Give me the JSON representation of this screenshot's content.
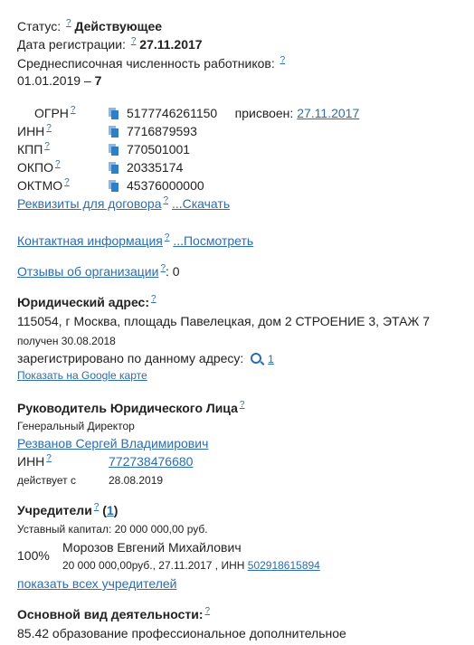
{
  "status": {
    "label": "Статус:",
    "q": "?",
    "value": "Действующее"
  },
  "reg_date": {
    "label": "Дата регистрации:",
    "q": "?",
    "value": "27.11.2017"
  },
  "headcount": {
    "label": "Среднесписочная численность работников:",
    "q": "?",
    "date": "01.01.2019",
    "dash": "–",
    "value": "7"
  },
  "codes": {
    "ogrn": {
      "label": "ОГРН",
      "q": "?",
      "value": "5177746261150",
      "assigned_label": "присвоен:",
      "assigned_date": "27.11.2017"
    },
    "inn": {
      "label": "ИНН",
      "q": "?",
      "value": "7716879593"
    },
    "kpp": {
      "label": "КПП",
      "q": "?",
      "value": "770501001"
    },
    "okpo": {
      "label": "ОКПО",
      "q": "?",
      "value": "20335174"
    },
    "oktmo": {
      "label": "ОКТМО",
      "q": "?",
      "value": "45376000000"
    }
  },
  "requisites": {
    "link": "Реквизиты для договора",
    "q": "?",
    "action": "...Скачать"
  },
  "contacts": {
    "link": "Контактная информация",
    "q": "?",
    "action": "...Посмотреть"
  },
  "reviews": {
    "link": "Отзывы об организации",
    "q": "?",
    "count": ": 0"
  },
  "address": {
    "title": "Юридический адрес:",
    "q": "?",
    "value": "115054, г Москва, площадь Павелецкая, дом 2 СТРОЕНИЕ 3, ЭТАЖ 7",
    "received": "получен 30.08.2018",
    "registered_label": "зарегистрировано по данному адресу:",
    "registered_count": "1",
    "map_link": "Показать на Google карте"
  },
  "head": {
    "title": "Руководитель Юридического Лица",
    "q": "?",
    "position": "Генеральный Директор",
    "name": "Резванов Сергей Владимирович",
    "inn_label": "ИНН",
    "inn_q": "?",
    "inn_value": "772738476680",
    "since_label": "действует с",
    "since_value": "28.08.2019"
  },
  "founders": {
    "title": "Учредители",
    "q": "?",
    "count_open": "(",
    "count": "1",
    "count_close": ")",
    "capital": "Уставный капитал: 20 000 000,00 руб.",
    "share": "100%",
    "founder_name": "Морозов Евгений Михайлович",
    "founder_details": "20 000 000,00руб., 27.11.2017 , ИНН",
    "founder_inn": "502918615894",
    "show_all": "показать всех учредителей"
  },
  "activity": {
    "title": "Основной вид деятельности:",
    "q": "?",
    "value": "85.42 образование профессиональное дополнительное"
  },
  "colors": {
    "link": "#2a6db0",
    "text": "#222222",
    "icon": "#2f7fc7"
  }
}
